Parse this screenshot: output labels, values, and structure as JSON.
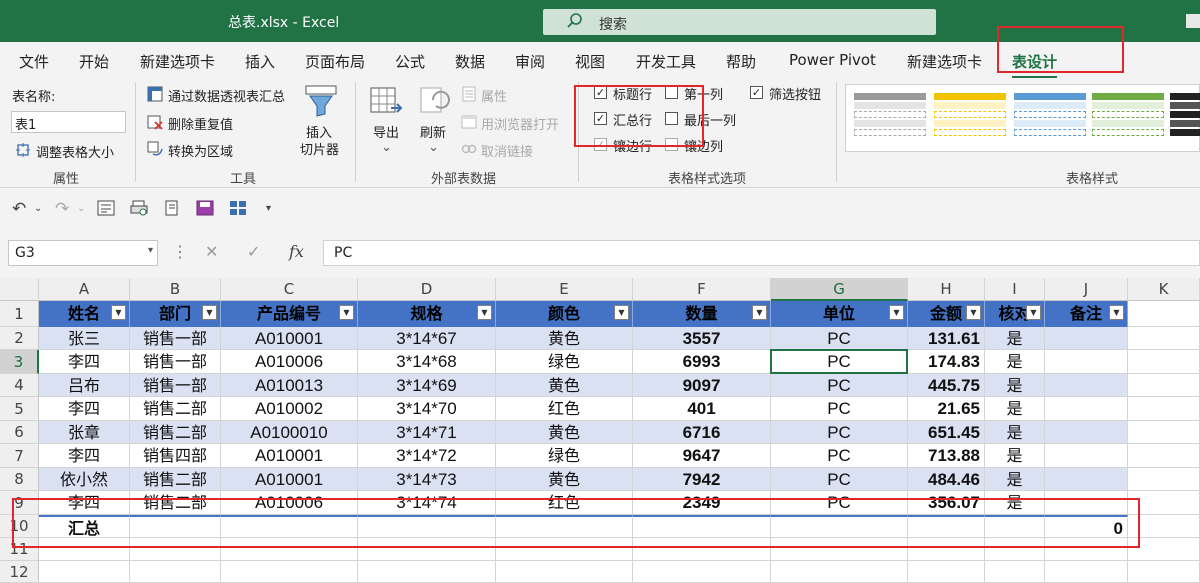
{
  "title": "总表.xlsx  -  Excel",
  "search_placeholder": "搜索",
  "menu": [
    "文件",
    "开始",
    "新建选项卡",
    "插入",
    "页面布局",
    "公式",
    "数据",
    "审阅",
    "视图",
    "开发工具",
    "帮助",
    "Power Pivot",
    "新建选项卡",
    "表设计"
  ],
  "ribbon": {
    "props": {
      "table_name_label": "表名称:",
      "table_name": "表1",
      "resize": "调整表格大小",
      "group": "属性"
    },
    "tools": {
      "pivot": "通过数据透视表汇总",
      "dedupe": "删除重复值",
      "convert": "转换为区域",
      "slicer1": "插入",
      "slicer2": "切片器",
      "group": "工具"
    },
    "external": {
      "export": "导出",
      "refresh": "刷新",
      "props": "属性",
      "browser": "用浏览器打开",
      "unlink": "取消链接",
      "group": "外部表数据"
    },
    "style_options": {
      "header_row": "标题行",
      "first_col": "第一列",
      "filter_btn": "筛选按钮",
      "total_row": "汇总行",
      "last_col": "最后一列",
      "banded_rows": "镶边行",
      "banded_cols": "镶边列",
      "group": "表格样式选项"
    },
    "styles_group": "表格样式"
  },
  "formula": {
    "cell_ref": "G3",
    "value": "PC",
    "fx": "fx"
  },
  "columns": [
    "A",
    "B",
    "C",
    "D",
    "E",
    "F",
    "G",
    "H",
    "I",
    "J",
    "K"
  ],
  "rows": [
    "1",
    "2",
    "3",
    "4",
    "5",
    "6",
    "7",
    "8",
    "9",
    "10",
    "11",
    "12"
  ],
  "headers": [
    "姓名",
    "部门",
    "产品编号",
    "规格",
    "颜色",
    "数量",
    "单位",
    "金额",
    "核对",
    "备注"
  ],
  "data": [
    [
      "张三",
      "销售一部",
      "A010001",
      "3*14*67",
      "黄色",
      "3557",
      "PC",
      "131.61",
      "是",
      ""
    ],
    [
      "李四",
      "销售一部",
      "A010006",
      "3*14*68",
      "绿色",
      "6993",
      "PC",
      "174.83",
      "是",
      ""
    ],
    [
      "吕布",
      "销售一部",
      "A010013",
      "3*14*69",
      "黄色",
      "9097",
      "PC",
      "445.75",
      "是",
      ""
    ],
    [
      "李四",
      "销售二部",
      "A010002",
      "3*14*70",
      "红色",
      "401",
      "PC",
      "21.65",
      "是",
      ""
    ],
    [
      "张章",
      "销售二部",
      "A0100010",
      "3*14*71",
      "黄色",
      "6716",
      "PC",
      "651.45",
      "是",
      ""
    ],
    [
      "李四",
      "销售四部",
      "A010001",
      "3*14*72",
      "绿色",
      "9647",
      "PC",
      "713.88",
      "是",
      ""
    ],
    [
      "依小然",
      "销售二部",
      "A010001",
      "3*14*73",
      "黄色",
      "7942",
      "PC",
      "484.46",
      "是",
      ""
    ],
    [
      "李四",
      "销售二部",
      "A010006",
      "3*14*74",
      "红色",
      "2349",
      "PC",
      "356.07",
      "是",
      ""
    ]
  ],
  "total_row": [
    "汇总",
    "",
    "",
    "",
    "",
    "",
    "",
    "",
    "",
    "0"
  ]
}
